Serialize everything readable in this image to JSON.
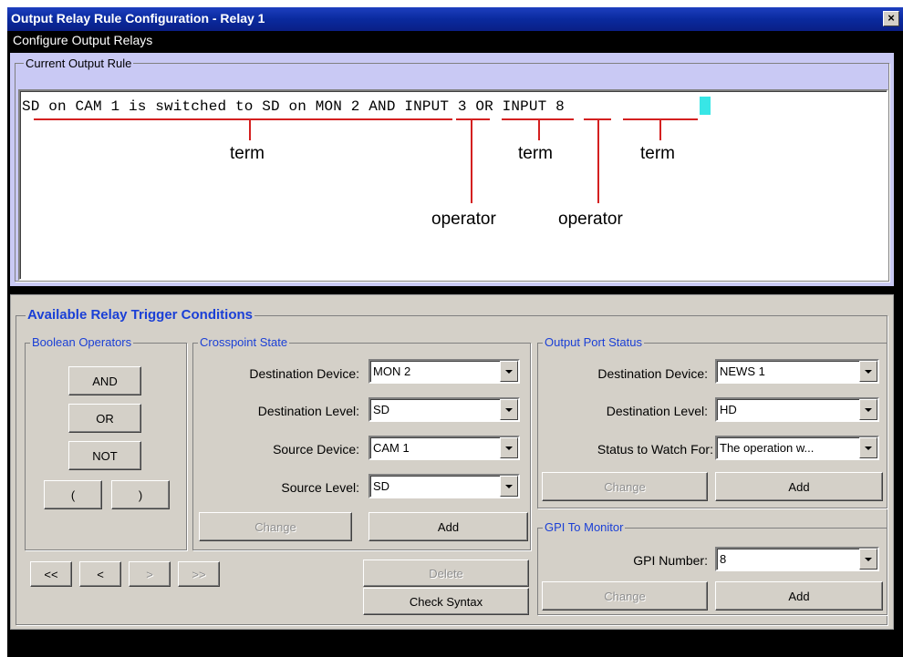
{
  "window": {
    "title": "Output Relay Rule Configuration - Relay 1",
    "close_label": "×",
    "subtitle": "Configure Output Relays"
  },
  "current_rule": {
    "legend": "Current Output Rule",
    "text": "SD on CAM 1 is switched to SD on MON 2 AND INPUT 3 OR INPUT 8",
    "annotations": {
      "term1": "term",
      "term2": "term",
      "term3": "term",
      "operator1": "operator",
      "operator2": "operator"
    }
  },
  "available": {
    "title": "Available Relay Trigger Conditions",
    "boolean": {
      "legend": "Boolean Operators",
      "and_label": "AND",
      "or_label": "OR",
      "not_label": "NOT",
      "open_paren_label": "(",
      "close_paren_label": ")"
    },
    "crosspoint": {
      "legend": "Crosspoint State",
      "dest_device_label": "Destination Device:",
      "dest_device_value": "MON 2",
      "dest_level_label": "Destination Level:",
      "dest_level_value": "SD",
      "source_device_label": "Source Device:",
      "source_device_value": "CAM 1",
      "source_level_label": "Source Level:",
      "source_level_value": "SD",
      "change_label": "Change",
      "add_label": "Add"
    },
    "output_port": {
      "legend": "Output Port Status",
      "dest_device_label": "Destination Device:",
      "dest_device_value": "NEWS 1",
      "dest_level_label": "Destination Level:",
      "dest_level_value": "HD",
      "status_label": "Status to Watch For:",
      "status_value": "The operation w...",
      "change_label": "Change",
      "add_label": "Add"
    },
    "gpi": {
      "legend": "GPI To Monitor",
      "number_label": "GPI Number:",
      "number_value": "8",
      "change_label": "Change",
      "add_label": "Add"
    },
    "nav": {
      "first_label": "<<",
      "prev_label": "<",
      "next_label": ">",
      "last_label": ">>"
    },
    "delete_label": "Delete",
    "check_syntax_label": "Check Syntax"
  },
  "colors": {
    "title_bar": "#0a2a9e",
    "rule_panel": "#c9c9f4",
    "annotation": "#d42020",
    "legend_text": "#1a3fd6",
    "cursor": "#38e6e6"
  }
}
